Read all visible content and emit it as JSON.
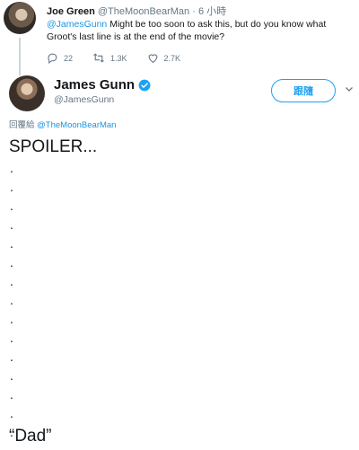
{
  "quoted_tweet": {
    "name": "Joe Green",
    "handle": "@TheMoonBearMan",
    "separator": "·",
    "time": "6 小時",
    "mention": "@JamesGunn",
    "text": " Might be too soon to ask this, but do you know what Groot's last line is at the end of the movie?",
    "actions": {
      "replies": "22",
      "retweets": "1.3K",
      "likes": "2.7K"
    }
  },
  "author": {
    "name": "James Gunn",
    "handle": "@JamesGunn",
    "follow_label": "跟隨"
  },
  "reply_context": {
    "prefix": "回覆給 ",
    "mention": "@TheMoonBearMan"
  },
  "tweet": {
    "spoiler": "SPOILER...",
    "dots": [
      ".",
      ".",
      ".",
      ".",
      ".",
      ".",
      ".",
      ".",
      ".",
      ".",
      ".",
      ".",
      ".",
      ".",
      "."
    ],
    "final": "“Dad”"
  },
  "colors": {
    "accent": "#1da1f2",
    "mention": "#1b95e0",
    "secondary_text": "#657786",
    "verified": "#1da1f2"
  },
  "icons": {
    "reply": "reply-icon",
    "retweet": "retweet-icon",
    "like": "heart-icon",
    "verified": "verified-badge-icon",
    "more": "chevron-down-icon"
  }
}
